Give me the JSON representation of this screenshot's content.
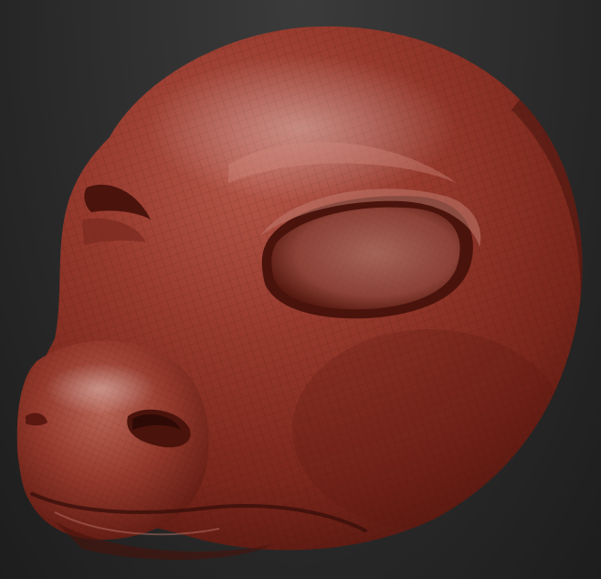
{
  "scene": {
    "subject": "sculpted-head-model",
    "material_color": "#8a2e22",
    "highlight_color": "#c9897d",
    "shadow_color": "#3a0f0a",
    "wire_color": "#2a0906",
    "background_top": "#3b3b3b",
    "background_bottom": "#1d1d1d"
  }
}
